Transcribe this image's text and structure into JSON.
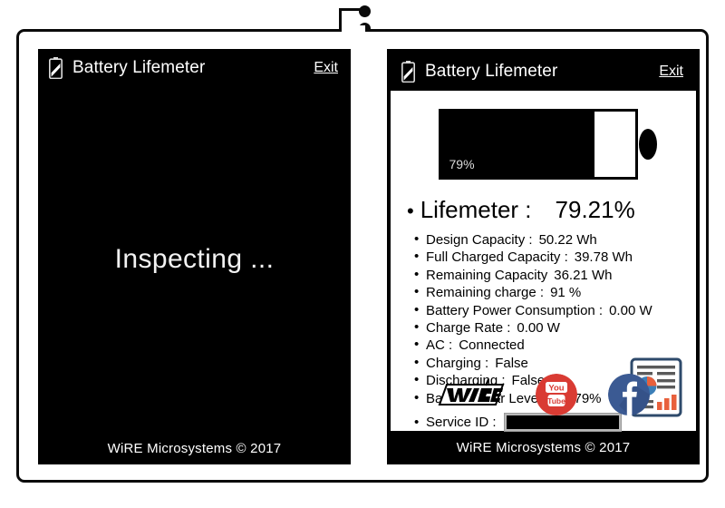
{
  "app": {
    "title": "Battery Lifemeter",
    "exit_label": "Exit",
    "footer": "WiRE Microsystems © 2017",
    "battery_icon": "battery-half-icon"
  },
  "left_panel": {
    "status_text": "Inspecting ..."
  },
  "right_panel": {
    "gauge": {
      "percent_label": "79%",
      "percent_value": 79
    },
    "lifemeter": {
      "label": "Lifemeter :",
      "value": "79.21%"
    },
    "details": [
      {
        "label": "Design Capacity :",
        "value": "50.22 Wh"
      },
      {
        "label": "Full Charged Capacity :",
        "value": "39.78 Wh"
      },
      {
        "label": "Remaining Capacity",
        "value": "36.21 Wh"
      },
      {
        "label": "Remaining charge :",
        "value": "91 %"
      },
      {
        "label": "Battery Power Consumption :",
        "value": "0.00 W"
      },
      {
        "label": "Charge Rate :",
        "value": "0.00 W"
      },
      {
        "label": "AC :",
        "value": "Connected"
      },
      {
        "label": "Charging :",
        "value": "False"
      },
      {
        "label": "Discharging :",
        "value": "False"
      },
      {
        "label": "Battery Wear Level :",
        "value": "20.79%"
      }
    ],
    "service_id": {
      "label": "Service ID :",
      "value": ""
    },
    "icons": {
      "report": "report-chart-icon",
      "wire": "wire-logo-icon",
      "youtube": "youtube-icon",
      "facebook": "facebook-icon"
    }
  },
  "colors": {
    "black": "#000000",
    "white": "#ffffff",
    "youtube_red": "#d93b33",
    "facebook_blue": "#3b5a93",
    "report_blue": "#3c7fb8",
    "report_orange": "#e8603c"
  }
}
